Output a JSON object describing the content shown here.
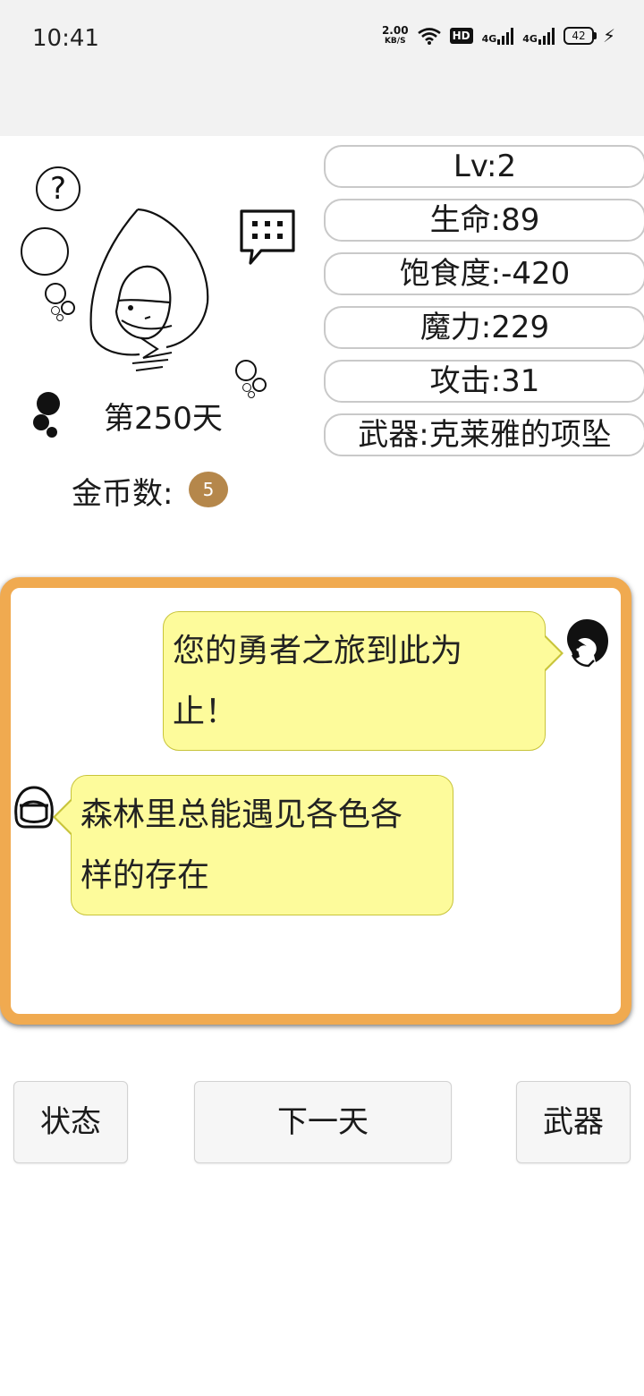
{
  "status_bar": {
    "time": "10:41",
    "net_speed": "2.00",
    "net_speed_unit": "KB/S",
    "hd_label": "HD",
    "signal1_label": "4G",
    "signal2_label": "4G",
    "battery": "42"
  },
  "character": {
    "day_text": "第250天",
    "coin_label": "金币数:",
    "coin_count": "5"
  },
  "stats": {
    "level": "Lv:2",
    "hp": "生命:89",
    "satiety": "饱食度:-420",
    "mana": "魔力:229",
    "attack": "攻击:31",
    "weapon": "武器:克莱雅的项坠"
  },
  "dialog": {
    "messages": [
      {
        "speaker": "npc",
        "line1": "您的勇者之旅到此为",
        "line2": "止！"
      },
      {
        "speaker": "hero",
        "line1": "森林里总能遇见各色各",
        "line2": "样的存在"
      }
    ]
  },
  "buttons": {
    "status": "状态",
    "next_day": "下一天",
    "weapon": "武器"
  },
  "colors": {
    "dialog_border": "#f0aa50",
    "bubble_fill": "#fdfb9b",
    "coin_badge": "#b5874b"
  }
}
